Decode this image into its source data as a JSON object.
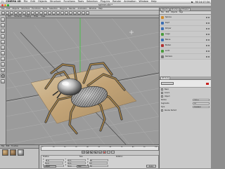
{
  "mac_menubar": {
    "app_name": "CINEMA 4D",
    "items": [
      "File",
      "Edit",
      "Objects",
      "Structure",
      "Functions",
      "Tools",
      "Selection",
      "Plug-ins",
      "Render",
      "Animation",
      "Window",
      "Help"
    ],
    "clock": "Mi 14:17:34"
  },
  "window": {
    "title": "spinne.c4d *"
  },
  "app_menu": {
    "items": [
      "File",
      "Edit",
      "Objects",
      "Structure",
      "Functions",
      "Tools",
      "Selection",
      "Plug-ins",
      "Render",
      "Animation",
      "Window",
      "Help"
    ]
  },
  "viewport": {
    "menu": [
      "Edit",
      "Cameras",
      "Display",
      "Filter",
      "View"
    ]
  },
  "object_manager": {
    "tabs": [
      "Objects",
      "Structure",
      "Browser"
    ],
    "menu": [
      "File",
      "Edit",
      "Objects",
      "Tags"
    ],
    "objects": [
      {
        "name": "Spinne",
        "color": "#d08a2a"
      },
      {
        "name": "Kopf",
        "color": "#3c6fb3"
      },
      {
        "name": "Körper",
        "color": "#3c6fb3"
      },
      {
        "name": "Auge",
        "color": "#4a9c3d"
      },
      {
        "name": "Beine",
        "color": "#3c6fb3"
      },
      {
        "name": "Boden",
        "color": "#b03030"
      },
      {
        "name": "Licht",
        "color": "#4a9c3d"
      },
      {
        "name": "Kamera",
        "color": "#777777"
      }
    ]
  },
  "attributes": {
    "title": "Attribute",
    "rows": [
      "Basic",
      "Coord.",
      "Object",
      "Radius",
      "Segments",
      "Type",
      "Render Perfect"
    ],
    "values": [
      "",
      "",
      "",
      "100 m",
      "24",
      "Standard",
      ""
    ]
  },
  "material_manager": {
    "menu": [
      "File",
      "Edit",
      "Function"
    ]
  },
  "timeline": {
    "ticks": [
      "0",
      "10",
      "20",
      "30",
      "40",
      "50",
      "60",
      "70",
      "80",
      "90",
      "100"
    ]
  },
  "coords": {
    "headers": [
      "Position",
      "Size",
      "Rotation"
    ],
    "rows": [
      [
        "X",
        "0 m",
        "Y",
        "0 m",
        "H",
        "0°"
      ],
      [
        "Y",
        "0 m",
        "Z",
        "0 m",
        "P",
        "0°"
      ],
      [
        "Z",
        "0 m",
        "X",
        "0 m",
        "B",
        "0°"
      ]
    ],
    "mode_left": "Object",
    "mode_right": "Size",
    "apply": "Apply"
  },
  "colors": {
    "accent_red": "#c8201e",
    "viewport_bg": "#9b9b9b",
    "grid_axis_green": "#2ecb2e"
  }
}
